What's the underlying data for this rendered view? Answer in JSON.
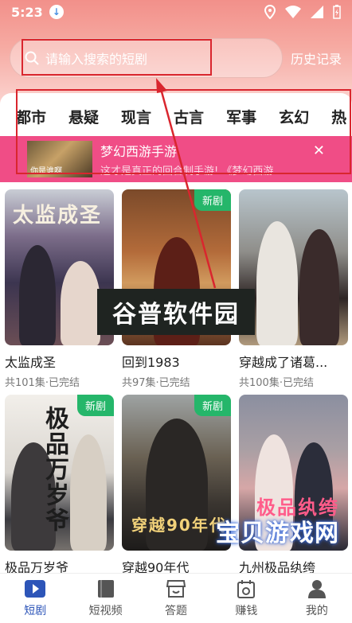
{
  "status": {
    "time": "5:23"
  },
  "search": {
    "placeholder": "请输入搜索的短剧",
    "history_label": "历史记录"
  },
  "categories": [
    "都市",
    "悬疑",
    "现言",
    "古言",
    "军事",
    "玄幻",
    "热"
  ],
  "promo": {
    "thumb_text": "你是谁啊",
    "title": "梦幻西游手游",
    "subtitle": "这才是真正的回合制手游! 《梦幻西游...",
    "close_glyph": "✕"
  },
  "dramas": [
    {
      "title": "太监成圣",
      "meta": "共101集·已完结",
      "badge": "",
      "poster_text": "太监成圣"
    },
    {
      "title": "回到1983",
      "meta": "共97集·已完结",
      "badge": "新剧",
      "poster_text": ""
    },
    {
      "title": "穿越成了诸葛...",
      "meta": "共100集·已完结",
      "badge": "",
      "poster_text": ""
    },
    {
      "title": "极品万岁爷",
      "meta": "",
      "badge": "新剧",
      "poster_text": "极品万岁爷"
    },
    {
      "title": "穿越90年代",
      "meta": "",
      "badge": "新剧",
      "poster_text": "穿越90年代"
    },
    {
      "title": "九州极品纨绔",
      "meta": "",
      "badge": "",
      "poster_text": "极品纨绔"
    }
  ],
  "watermarks": {
    "top": "谷普软件园",
    "bottom": "宝贝游戏网"
  },
  "tabs": [
    {
      "label": "短剧",
      "icon": "play-icon",
      "active": true
    },
    {
      "label": "短视频",
      "icon": "book-icon",
      "active": false
    },
    {
      "label": "答题",
      "icon": "shop-icon",
      "active": false
    },
    {
      "label": "赚钱",
      "icon": "calendar-icon",
      "active": false
    },
    {
      "label": "我的",
      "icon": "user-icon",
      "active": false
    }
  ],
  "colors": {
    "accent": "#2d55b8",
    "promo_bg": "#f04d86",
    "badge_new": "#25b66a",
    "annotation": "#d9262e"
  }
}
